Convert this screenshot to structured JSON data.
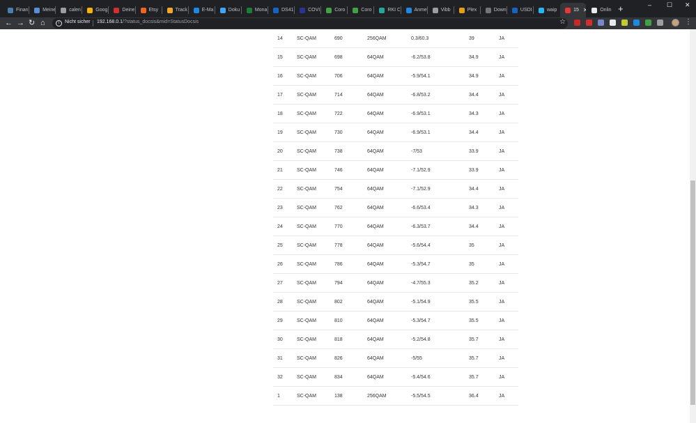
{
  "browser": {
    "tabs": [
      {
        "title": "Finan",
        "color": "#4a7fb5"
      },
      {
        "title": "Meine",
        "color": "#5a8fd6"
      },
      {
        "title": "calen",
        "color": "#9e9e9e"
      },
      {
        "title": "Goog",
        "color": "#f4b400"
      },
      {
        "title": "Deine",
        "color": "#d32f2f"
      },
      {
        "title": "Etsy",
        "color": "#f1641e"
      },
      {
        "title": "Track",
        "color": "#f9a825"
      },
      {
        "title": "E-Ma",
        "color": "#1e88e5"
      },
      {
        "title": "Doku",
        "color": "#42a5f5"
      },
      {
        "title": "Mona",
        "color": "#1e7e34"
      },
      {
        "title": "DS41",
        "color": "#1565c0"
      },
      {
        "title": "COVI",
        "color": "#283593"
      },
      {
        "title": "Coro",
        "color": "#43a047"
      },
      {
        "title": "Coro",
        "color": "#43a047"
      },
      {
        "title": "RKI C",
        "color": "#26a69a"
      },
      {
        "title": "Anme",
        "color": "#1e88e5"
      },
      {
        "title": "Vibb",
        "color": "#9e9e9e"
      },
      {
        "title": "Plex",
        "color": "#e5a00d"
      },
      {
        "title": "Down",
        "color": "#757575"
      },
      {
        "title": "USDI",
        "color": "#1565c0"
      },
      {
        "title": "waip",
        "color": "#29b6f6"
      },
      {
        "title": "15",
        "color": "#e53935",
        "active": true
      },
      {
        "title": "Onlin",
        "color": "#e8eaed"
      }
    ],
    "close_glyph": "✕",
    "new_tab_glyph": "+",
    "window_controls": {
      "minimize": "–",
      "maximize": "☐",
      "close": "✕"
    },
    "nav": {
      "back": "←",
      "forward": "→",
      "reload": "↻",
      "home": "⌂"
    },
    "address": {
      "info_glyph": "i",
      "security_label": "Nicht sicher",
      "host": "192.168.0.1",
      "path": "/?status_docsis&mid=StatusDocsis"
    },
    "star_glyph": "☆",
    "menu_glyph": "⋮",
    "extension_colors": [
      "#c62828",
      "#d32f2f",
      "#7986cb",
      "#e8eaed",
      "#c0ca33",
      "#1e88e5",
      "#43a047",
      "#9e9e9e"
    ]
  },
  "table": {
    "rows": [
      [
        "14",
        "SC-QAM",
        "690",
        "256QAM",
        "0.3/60.3",
        "39",
        "JA"
      ],
      [
        "15",
        "SC-QAM",
        "698",
        "64QAM",
        "-6.2/53.8",
        "34.9",
        "JA"
      ],
      [
        "16",
        "SC-QAM",
        "706",
        "64QAM",
        "-5.9/54.1",
        "34.9",
        "JA"
      ],
      [
        "17",
        "SC-QAM",
        "714",
        "64QAM",
        "-6.8/53.2",
        "34.4",
        "JA"
      ],
      [
        "18",
        "SC-QAM",
        "722",
        "64QAM",
        "-6.9/53.1",
        "34.3",
        "JA"
      ],
      [
        "19",
        "SC-QAM",
        "730",
        "64QAM",
        "-6.9/53.1",
        "34.4",
        "JA"
      ],
      [
        "20",
        "SC-QAM",
        "738",
        "64QAM",
        "-7/53",
        "33.9",
        "JA"
      ],
      [
        "21",
        "SC-QAM",
        "746",
        "64QAM",
        "-7.1/52.9",
        "33.9",
        "JA"
      ],
      [
        "22",
        "SC-QAM",
        "754",
        "64QAM",
        "-7.1/52.9",
        "34.4",
        "JA"
      ],
      [
        "23",
        "SC-QAM",
        "762",
        "64QAM",
        "-6.6/53.4",
        "34.3",
        "JA"
      ],
      [
        "24",
        "SC-QAM",
        "770",
        "64QAM",
        "-6.3/53.7",
        "34.4",
        "JA"
      ],
      [
        "25",
        "SC-QAM",
        "778",
        "64QAM",
        "-5.6/54.4",
        "35",
        "JA"
      ],
      [
        "26",
        "SC-QAM",
        "786",
        "64QAM",
        "-5.3/54.7",
        "35",
        "JA"
      ],
      [
        "27",
        "SC-QAM",
        "794",
        "64QAM",
        "-4.7/55.3",
        "35.2",
        "JA"
      ],
      [
        "28",
        "SC-QAM",
        "802",
        "64QAM",
        "-5.1/54.9",
        "35.5",
        "JA"
      ],
      [
        "29",
        "SC-QAM",
        "810",
        "64QAM",
        "-5.3/54.7",
        "35.5",
        "JA"
      ],
      [
        "30",
        "SC-QAM",
        "818",
        "64QAM",
        "-5.2/54.8",
        "35.7",
        "JA"
      ],
      [
        "31",
        "SC-QAM",
        "826",
        "64QAM",
        "-5/55",
        "35.7",
        "JA"
      ],
      [
        "32",
        "SC-QAM",
        "834",
        "64QAM",
        "-5.4/54.6",
        "35.7",
        "JA"
      ],
      [
        "1",
        "SC-QAM",
        "138",
        "256QAM",
        "-5.5/54.5",
        "36.4",
        "JA"
      ]
    ]
  }
}
